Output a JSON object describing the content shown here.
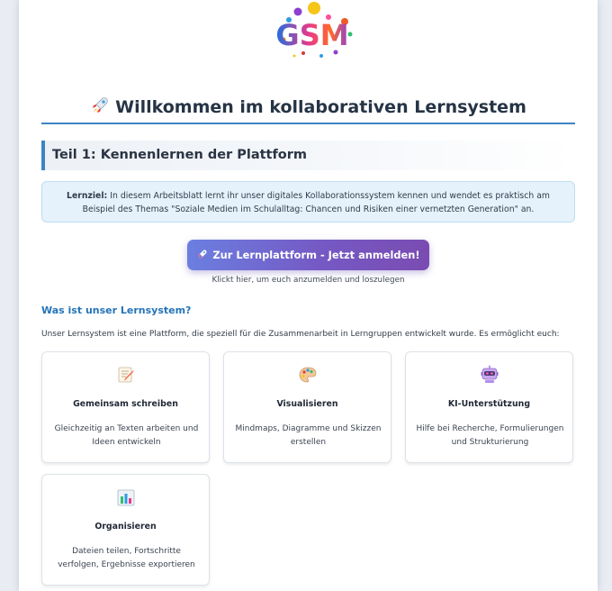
{
  "logo": {
    "text": "GSM"
  },
  "title": {
    "icon": "rocket-icon",
    "text": "Willkommen im kollaborativen Lernsystem"
  },
  "section": {
    "title": "Teil 1: Kennenlernen der Plattform"
  },
  "goal": {
    "label": "Lernziel:",
    "text": "In diesem Arbeitsblatt lernt ihr unser digitales Kollaborationssystem kennen und wendet es praktisch am Beispiel des Themas \"Soziale Medien im Schulalltag: Chancen und Risiken einer vernetzten Generation\" an."
  },
  "cta": {
    "icon": "rocket-icon",
    "label": "Zur Lernplattform - Jetzt anmelden!",
    "hint": "Klickt hier, um euch anzumelden und loszulegen"
  },
  "about": {
    "heading": "Was ist unser Lernsystem?",
    "intro": "Unser Lernsystem ist eine Plattform, die speziell für die Zusammenarbeit in Lerngruppen entwickelt wurde. Es ermöglicht euch:"
  },
  "features": [
    {
      "icon": "memo-pencil-icon",
      "title": "Gemeinsam schreiben",
      "desc": "Gleichzeitig an Texten arbeiten und Ideen entwickeln"
    },
    {
      "icon": "palette-icon",
      "title": "Visualisieren",
      "desc": "Mindmaps, Diagramme und Skizzen erstellen"
    },
    {
      "icon": "robot-icon",
      "title": "KI-Unterstützung",
      "desc": "Hilfe bei Recherche, Formulierungen und Strukturierung"
    },
    {
      "icon": "bar-chart-icon",
      "title": "Organisieren",
      "desc": "Dateien teilen, Fortschritte verfolgen, Ergebnisse exportieren"
    }
  ],
  "colors": {
    "accent": "#3d84c5",
    "heading_blue": "#2474b8",
    "cta_start": "#6b7fe0",
    "cta_end": "#7a4cb2",
    "goal_bg": "#e6f2fb"
  }
}
